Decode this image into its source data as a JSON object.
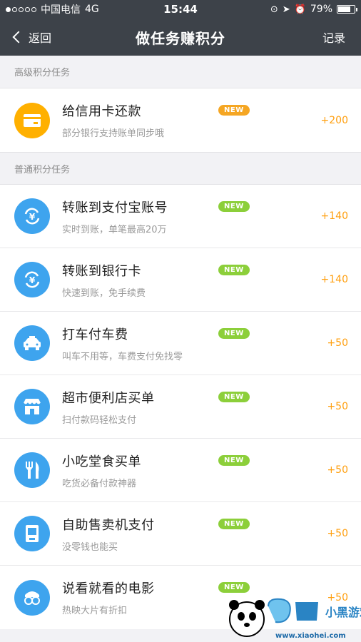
{
  "status_bar": {
    "carrier": "中国电信",
    "network": "4G",
    "time": "15:44",
    "battery": "79%",
    "battery_level": 0.79
  },
  "nav": {
    "back_label": "返回",
    "title": "做任务赚积分",
    "record_label": "记录"
  },
  "sections": [
    {
      "header": "高级积分任务",
      "items": [
        {
          "title": "给信用卡还款",
          "subtitle": "部分银行支持账单同步哦",
          "badge": "NEW",
          "badge_color": "#f5a623",
          "points": "+200",
          "icon": "credit-card-icon",
          "icon_color": "#ffb000"
        }
      ]
    },
    {
      "header": "普通积分任务",
      "items": [
        {
          "title": "转账到支付宝账号",
          "subtitle": "实时到账，单笔最高20万",
          "badge": "NEW",
          "badge_color": "#8ccf3a",
          "points": "+140",
          "icon": "transfer-icon",
          "icon_color": "#3ea4ee"
        },
        {
          "title": "转账到银行卡",
          "subtitle": "快速到账，免手续费",
          "badge": "NEW",
          "badge_color": "#8ccf3a",
          "points": "+140",
          "icon": "transfer-bank-icon",
          "icon_color": "#3ea4ee"
        },
        {
          "title": "打车付车费",
          "subtitle": "叫车不用等，车费支付免找零",
          "badge": "NEW",
          "badge_color": "#8ccf3a",
          "points": "+50",
          "icon": "taxi-icon",
          "icon_color": "#3ea4ee"
        },
        {
          "title": "超市便利店买单",
          "subtitle": "扫付款码轻松支付",
          "badge": "NEW",
          "badge_color": "#8ccf3a",
          "points": "+50",
          "icon": "store-icon",
          "icon_color": "#3ea4ee"
        },
        {
          "title": "小吃堂食买单",
          "subtitle": "吃货必备付款神器",
          "badge": "NEW",
          "badge_color": "#8ccf3a",
          "points": "+50",
          "icon": "fork-knife-icon",
          "icon_color": "#3ea4ee"
        },
        {
          "title": "自助售卖机支付",
          "subtitle": "没零钱也能买",
          "badge": "NEW",
          "badge_color": "#8ccf3a",
          "points": "+50",
          "icon": "vending-machine-icon",
          "icon_color": "#3ea4ee"
        },
        {
          "title": "说看就看的电影",
          "subtitle": "热映大片有折扣",
          "badge": "NEW",
          "badge_color": "#8ccf3a",
          "points": "+50",
          "icon": "movie-glasses-icon",
          "icon_color": "#3ea4ee"
        }
      ]
    }
  ],
  "watermark": {
    "text": "小黑游戏",
    "url_text": "www.xiaohei.com"
  }
}
